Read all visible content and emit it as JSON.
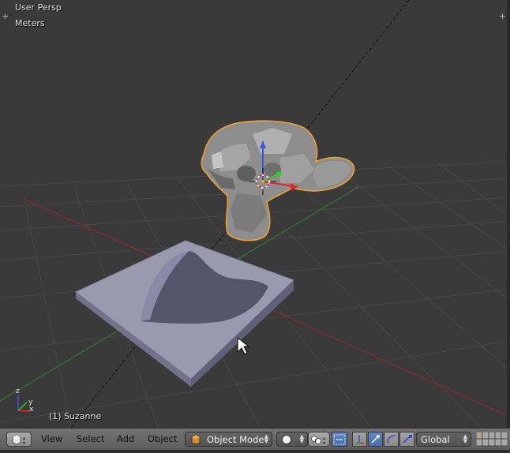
{
  "viewport": {
    "view_label": "User Persp",
    "units_label": "Meters",
    "object_label": "(1) Suzanne",
    "axis_gizmo": {
      "x": "x",
      "y": "y",
      "z": "z"
    }
  },
  "header": {
    "menus": [
      {
        "label": "View"
      },
      {
        "label": "Select"
      },
      {
        "label": "Add"
      },
      {
        "label": "Object"
      }
    ],
    "mode_label": "Object Mode",
    "orientation_label": "Global"
  },
  "colors": {
    "viewport_bg": "#3a3a3a",
    "grid_line": "#454545",
    "x_axis": "#8a2a2a",
    "y_axis": "#2f7a2f",
    "selection_outline": "#f0a030",
    "mesh": "#8f8f98",
    "header_bg": "#6a6a6a",
    "active_tool": "#5680c2"
  },
  "icons": [
    "editor-type-cube-icon",
    "object-mode-cube-icon",
    "viewport-shading-sphere-icon",
    "pivot-point-icon",
    "manipulator-toggle-icon",
    "translate-arrow-icon",
    "rotate-arc-icon",
    "scale-icon",
    "layers-grid-icon",
    "mouse-cursor-icon"
  ]
}
